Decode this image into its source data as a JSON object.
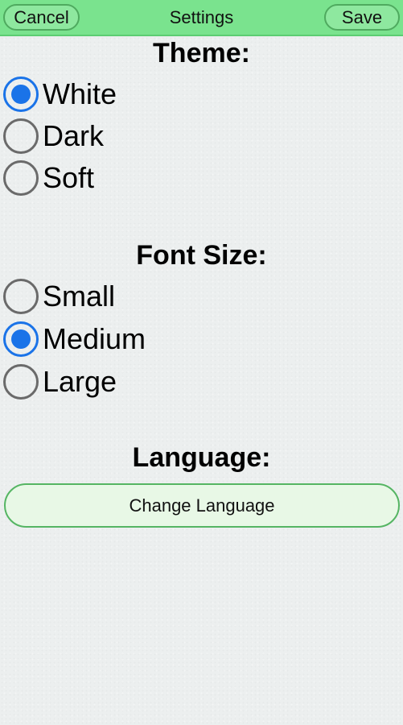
{
  "header": {
    "cancel_label": "Cancel",
    "title": "Settings",
    "save_label": "Save"
  },
  "theme": {
    "heading": "Theme:",
    "options": [
      {
        "label": "White",
        "selected": true
      },
      {
        "label": "Dark",
        "selected": false
      },
      {
        "label": "Soft",
        "selected": false
      }
    ]
  },
  "font_size": {
    "heading": "Font Size:",
    "options": [
      {
        "label": "Small",
        "selected": false
      },
      {
        "label": "Medium",
        "selected": true
      },
      {
        "label": "Large",
        "selected": false
      }
    ]
  },
  "language": {
    "heading": "Language:",
    "button_label": "Change Language"
  },
  "colors": {
    "header_bg": "#7ae38e",
    "radio_selected": "#1a73e8",
    "button_bg": "#e8f8e6",
    "page_bg": "#ecefef"
  }
}
